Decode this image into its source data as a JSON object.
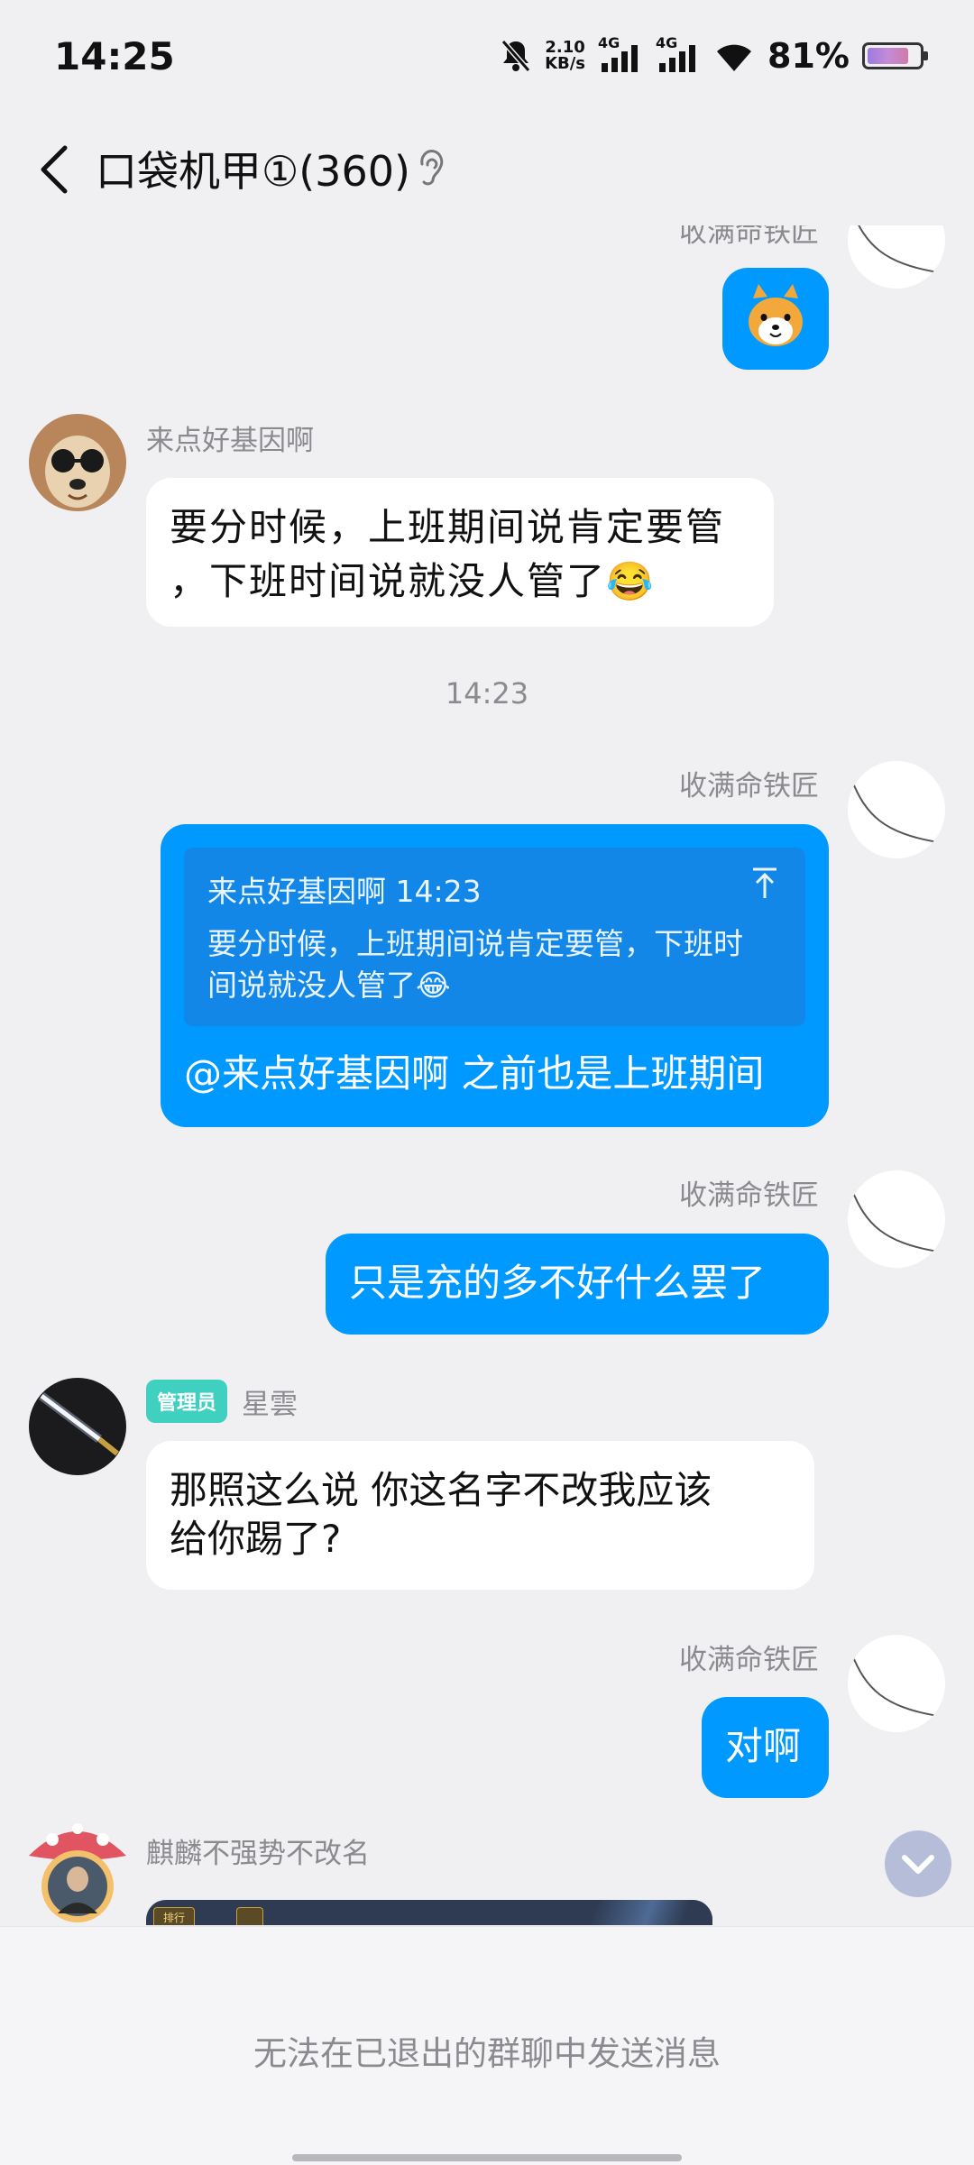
{
  "status_bar": {
    "time": "14:25",
    "net_speed_value": "2.10",
    "net_speed_unit": "KB/s",
    "sim1": "4G",
    "sim2": "4G",
    "battery": "81%",
    "battery_level": 0.81
  },
  "header": {
    "title": "口袋机甲①(360)"
  },
  "messages": [
    {
      "sender": "收满命铁匠",
      "side": "right",
      "type": "sticker"
    },
    {
      "sender": "来点好基因啊",
      "side": "left",
      "text_line1": "要分时候，上班期间说肯定要管",
      "text_line2": "，下班时间说就没人管了😂"
    },
    {
      "timestamp": "14:23"
    },
    {
      "sender": "收满命铁匠",
      "side": "right",
      "quote_header": "来点好基因啊 14:23",
      "quote_line1": "要分时候，上班期间说肯定要管，下班时",
      "quote_line2": "间说就没人管了😂",
      "text": "@来点好基因啊 之前也是上班期间"
    },
    {
      "sender": "收满命铁匠",
      "side": "right",
      "text": "只是充的多不好什么罢了"
    },
    {
      "sender": "星雲",
      "badge": "管理员",
      "side": "left",
      "text_line1": "那照这么说 你这名字不改我应该",
      "text_line2": "给你踢了?"
    },
    {
      "sender": "收满命铁匠",
      "side": "right",
      "text": "对啊"
    },
    {
      "sender": "麒麟不强势不改名",
      "side": "left",
      "type": "image",
      "image_label": "排行"
    }
  ],
  "footer": {
    "notice": "无法在已退出的群聊中发送消息"
  },
  "colors": {
    "self_bubble": "#0099ff",
    "other_bubble": "#ffffff",
    "background": "#f0f0f3",
    "admin_badge": "#3fd0c0"
  }
}
